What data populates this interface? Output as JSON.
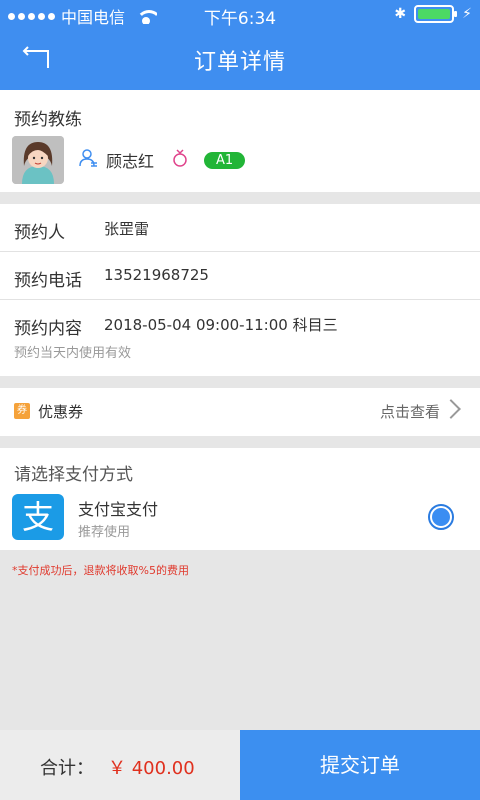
{
  "status_bar": {
    "carrier": "中国电信",
    "time": "下午6:34",
    "battery_level": 1.0
  },
  "header": {
    "title": "订单详情",
    "back_icon": "back-arrow-icon"
  },
  "coach": {
    "label": "预约教练",
    "name": "顾志红",
    "license_badge": "A1",
    "gender_icon": "female-icon",
    "person_icon": "person-icon"
  },
  "booking": {
    "booker_label": "预约人",
    "booker_value": "张罡雷",
    "phone_label": "预约电话",
    "phone_value": "13521968725",
    "content_label": "预约内容",
    "content_value": "2018-05-04 09:00-11:00 科目三",
    "validity_note": "预约当天内使用有效"
  },
  "coupon": {
    "icon_text": "券",
    "label": "优惠券",
    "action": "点击查看"
  },
  "payment": {
    "title": "请选择支付方式",
    "method_name": "支付宝支付",
    "method_sub": "推荐使用",
    "icon_text": "支",
    "selected": true
  },
  "notice": {
    "refund_text": "*支付成功后，退款将收取%5的费用"
  },
  "footer": {
    "total_label": "合计：",
    "total_amount": "￥ 400.00",
    "submit_label": "提交订单"
  },
  "colors": {
    "primary_blue": "#3f8ef0",
    "badge_green": "#22b537",
    "price_red": "#e0301e",
    "coupon_orange": "#f5a23a"
  }
}
